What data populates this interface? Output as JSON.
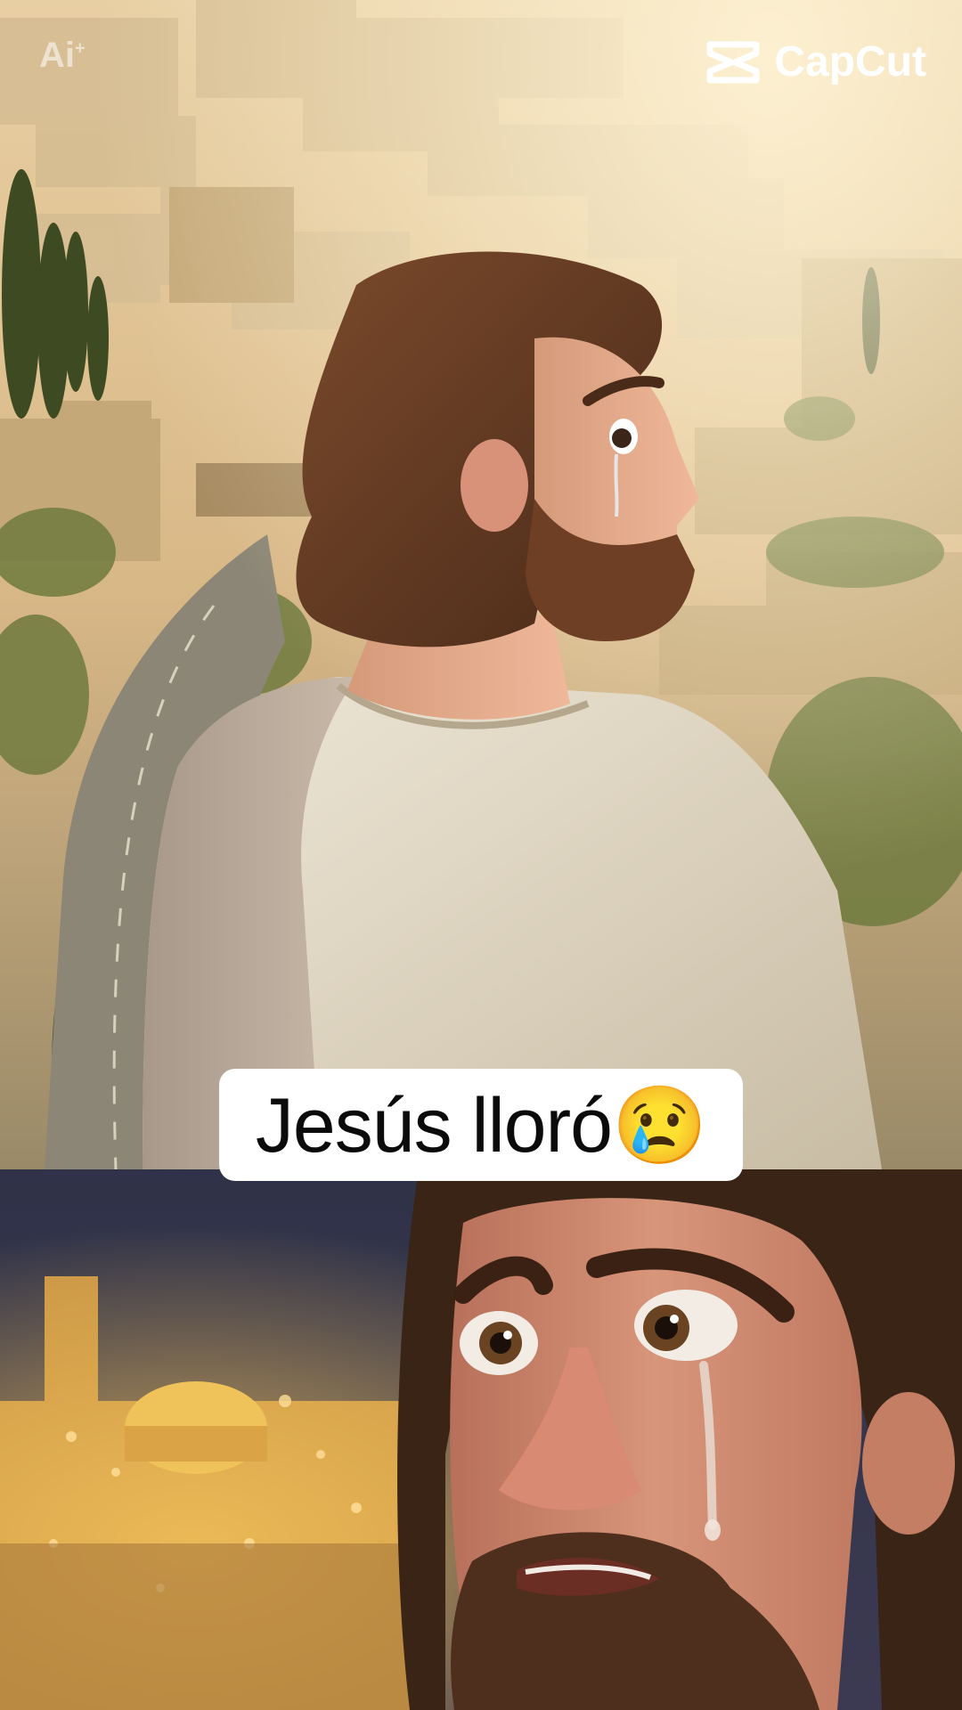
{
  "watermark": {
    "ai_label": "Ai",
    "ai_sup": "+",
    "brand": "CapCut"
  },
  "caption": {
    "text": "Jesús lloró😢"
  }
}
